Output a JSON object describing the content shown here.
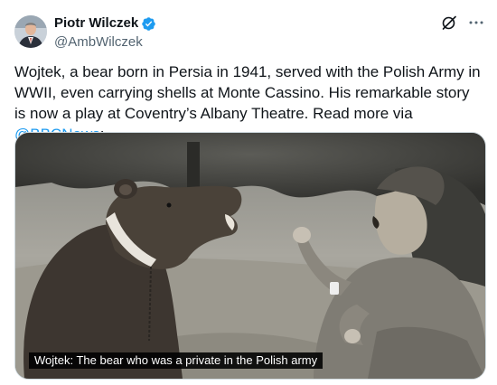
{
  "author": {
    "name": "Piotr Wilczek",
    "handle": "@AmbWilczek",
    "verified": true
  },
  "icons": {
    "verified": "verified-badge-icon",
    "grok": "grok-icon",
    "more": "more-options-icon"
  },
  "tweet": {
    "text_before": "Wojtek, a bear born in Persia in 1941, served with the Polish Army in WWII, even carrying shells at Monte Cassino. His remarkable story is now a play at Coventry’s Albany Theatre. Read more via ",
    "mention": "@BBCNews",
    "text_after": ":"
  },
  "media": {
    "caption": "Wojtek: The bear who was a private in the Polish army"
  },
  "colors": {
    "accent": "#1d9bf0",
    "text": "#0f1419",
    "secondary": "#536471",
    "border": "#cfd9de"
  }
}
